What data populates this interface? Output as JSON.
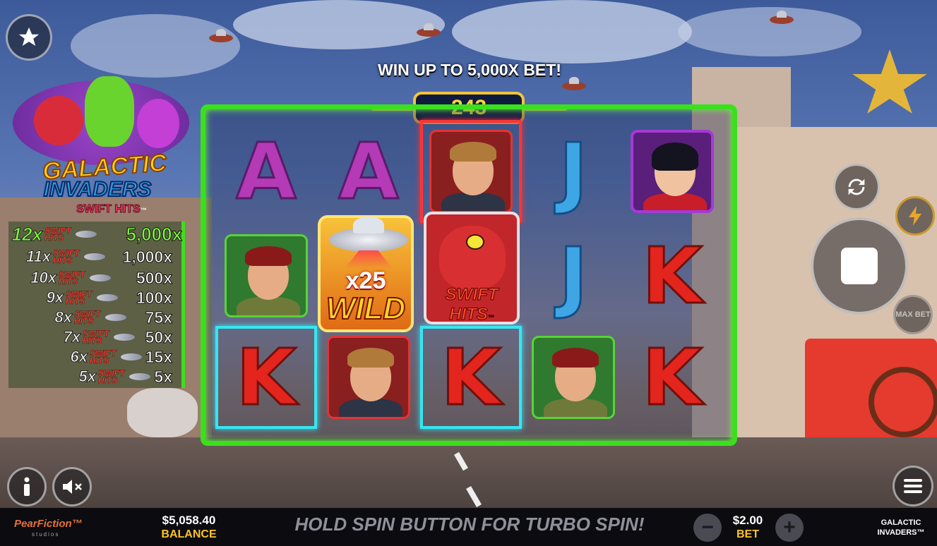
{
  "headline": "WIN UP TO 5,000X BET!",
  "ways_count": "243",
  "logo": {
    "line1": "GALACTIC",
    "line2": "INVADERS",
    "line3": "SWIFT HITS",
    "tm": "™"
  },
  "paytable": [
    {
      "mult": "12x",
      "swift": "SWIFT HITS",
      "pay": "5,000x",
      "highlight": true
    },
    {
      "mult": "11x",
      "swift": "SWIFT HITS",
      "pay": "1,000x"
    },
    {
      "mult": "10x",
      "swift": "SWIFT HITS",
      "pay": "500x"
    },
    {
      "mult": "9x",
      "swift": "SWIFT HITS",
      "pay": "100x"
    },
    {
      "mult": "8x",
      "swift": "SWIFT HITS",
      "pay": "75x"
    },
    {
      "mult": "7x",
      "swift": "SWIFT HITS",
      "pay": "50x"
    },
    {
      "mult": "6x",
      "swift": "SWIFT HITS",
      "pay": "15x"
    },
    {
      "mult": "5x",
      "swift": "SWIFT HITS",
      "pay": "5x"
    }
  ],
  "reels": [
    [
      "A",
      "soldier",
      "K"
    ],
    [
      "A",
      "wild",
      "agent"
    ],
    [
      "agent",
      "swift-hits",
      "K"
    ],
    [
      "J",
      "J",
      "soldier"
    ],
    [
      "lady",
      "K",
      "K"
    ]
  ],
  "symbols": {
    "A": "A",
    "J": "J",
    "K": "K"
  },
  "wild": {
    "multiplier": "x25",
    "label": "WILD"
  },
  "swift_card": {
    "label1": "SWIFT",
    "label2": "HITS",
    "tm": "™"
  },
  "controls": {
    "favorite_icon": "star-icon",
    "autoplay_icon": "refresh-icon",
    "turbo_icon": "lightning-icon",
    "spin_icon": "stop-square-icon",
    "max_bet_label": "MAX BET",
    "info_icon": "info-icon",
    "sound_icon": "mute-icon",
    "menu_icon": "hamburger-icon"
  },
  "bottom_bar": {
    "brand": "PearFiction™",
    "brand_sub": "studios",
    "balance_value": "$5,058.40",
    "balance_label": "BALANCE",
    "message": "HOLD SPIN BUTTON FOR TURBO SPIN!",
    "minus": "−",
    "plus": "+",
    "bet_value": "$2.00",
    "bet_label": "BET",
    "game_name_line1": "GALACTIC",
    "game_name_line2": "INVADERS™"
  },
  "colors": {
    "frame_green": "#3be01c",
    "ways_gold": "#ffd33b",
    "accent_yellow": "#ffc225",
    "win_blue": "#35e6f2",
    "win_red": "#ff3434"
  }
}
